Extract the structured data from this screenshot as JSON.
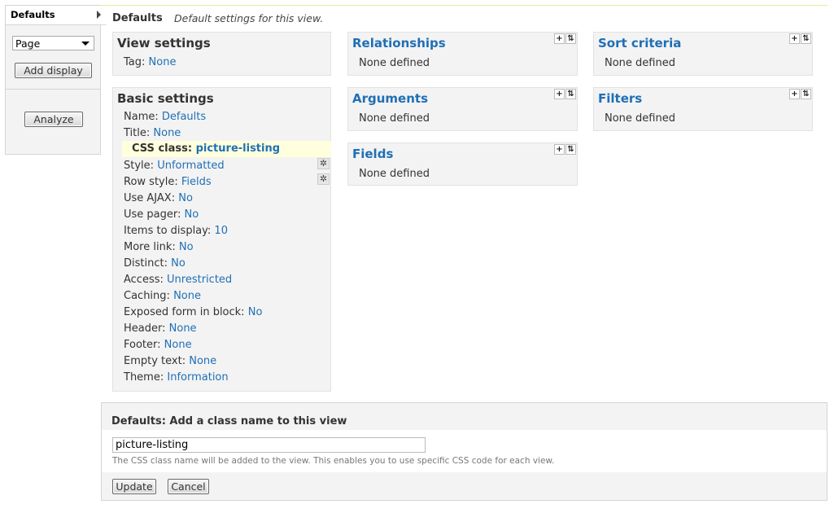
{
  "sidebar": {
    "active_tab": "Defaults",
    "display_select": "Page",
    "add_display": "Add display",
    "analyze": "Analyze"
  },
  "header": {
    "title": "Defaults",
    "description": "Default settings for this view."
  },
  "view_settings": {
    "title": "View settings",
    "tag_label": "Tag:",
    "tag_value": "None"
  },
  "basic_settings": {
    "title": "Basic settings",
    "rows": [
      {
        "label": "Name:",
        "value": "Defaults"
      },
      {
        "label": "Title:",
        "value": "None"
      },
      {
        "label": "CSS class:",
        "value": "picture-listing"
      },
      {
        "label": "Style:",
        "value": "Unformatted"
      },
      {
        "label": "Row style:",
        "value": "Fields"
      },
      {
        "label": "Use AJAX:",
        "value": "No"
      },
      {
        "label": "Use pager:",
        "value": "No"
      },
      {
        "label": "Items to display:",
        "value": "10"
      },
      {
        "label": "More link:",
        "value": "No"
      },
      {
        "label": "Distinct:",
        "value": "No"
      },
      {
        "label": "Access:",
        "value": "Unrestricted"
      },
      {
        "label": "Caching:",
        "value": "None"
      },
      {
        "label": "Exposed form in block:",
        "value": "No"
      },
      {
        "label": "Header:",
        "value": "None"
      },
      {
        "label": "Footer:",
        "value": "None"
      },
      {
        "label": "Empty text:",
        "value": "None"
      },
      {
        "label": "Theme:",
        "value": "Information"
      }
    ]
  },
  "sections": {
    "relationships": {
      "title": "Relationships",
      "empty": "None defined"
    },
    "arguments": {
      "title": "Arguments",
      "empty": "None defined"
    },
    "fields": {
      "title": "Fields",
      "empty": "None defined"
    },
    "sort_criteria": {
      "title": "Sort criteria",
      "empty": "None defined"
    },
    "filters": {
      "title": "Filters",
      "empty": "None defined"
    }
  },
  "icons": {
    "add": "+",
    "rearrange": "⇅",
    "gear": "✲"
  },
  "form": {
    "title": "Defaults: Add a class name to this view",
    "input_value": "picture-listing",
    "description": "The CSS class name will be added to the view. This enables you to use specific CSS code for each view.",
    "update": "Update",
    "cancel": "Cancel"
  }
}
